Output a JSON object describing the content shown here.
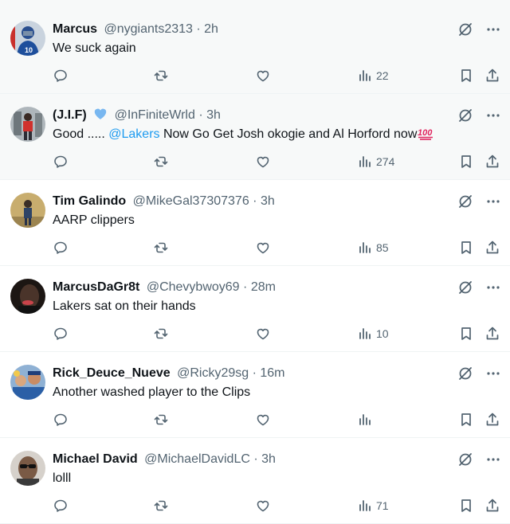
{
  "colors": {
    "text": "#0f1419",
    "secondary": "#536471",
    "link": "#1d9bf0",
    "shaded_background": "#f7f9f9",
    "verified": "#78b7f0"
  },
  "tweets": [
    {
      "name": "Marcus",
      "handle": "@nygiants2313",
      "separator": "·",
      "time": "2h",
      "text": "We suck again",
      "views": "22",
      "verified": false,
      "avatar_icon": "football-player-avatar",
      "avatar_color": "#1e4f9c"
    },
    {
      "name": "(J.I.F)",
      "handle": "@InFiniteWrld",
      "separator": "·",
      "time": "3h",
      "text_prefix": "Good ..... ",
      "mention": "@Lakers",
      "text_suffix": " Now Go Get Josh okogie and Al Horford now",
      "emoji": "hundred-points-emoji",
      "views": "274",
      "verified": true,
      "verified_icon": "blue-heart-icon",
      "avatar_icon": "person-red-shirt-avatar",
      "avatar_color": "#9aa3a8"
    },
    {
      "name": "Tim Galindo",
      "handle": "@MikeGal37307376",
      "separator": "·",
      "time": "3h",
      "text": "AARP clippers",
      "views": "85",
      "verified": false,
      "avatar_icon": "person-outdoor-avatar",
      "avatar_color": "#b79a5a"
    },
    {
      "name": "MarcusDaGr8t",
      "handle": "@Chevybwoy69",
      "separator": "·",
      "time": "28m",
      "text": "Lakers sat on their hands",
      "views": "10",
      "verified": false,
      "avatar_icon": "dark-portrait-avatar",
      "avatar_color": "#2b211d"
    },
    {
      "name": "Rick_Deuce_Nueve",
      "handle": "@Ricky29sg",
      "separator": "·",
      "time": "16m",
      "text": "Another washed player to the Clips",
      "views": "",
      "verified": false,
      "avatar_icon": "group-photo-avatar",
      "avatar_color": "#6f8fb3"
    },
    {
      "name": "Michael David",
      "handle": "@MichaelDavidLC",
      "separator": "·",
      "time": "3h",
      "text": "lolll",
      "views": "71",
      "verified": false,
      "avatar_icon": "sunglasses-person-avatar",
      "avatar_color": "#8c7a6b"
    }
  ]
}
